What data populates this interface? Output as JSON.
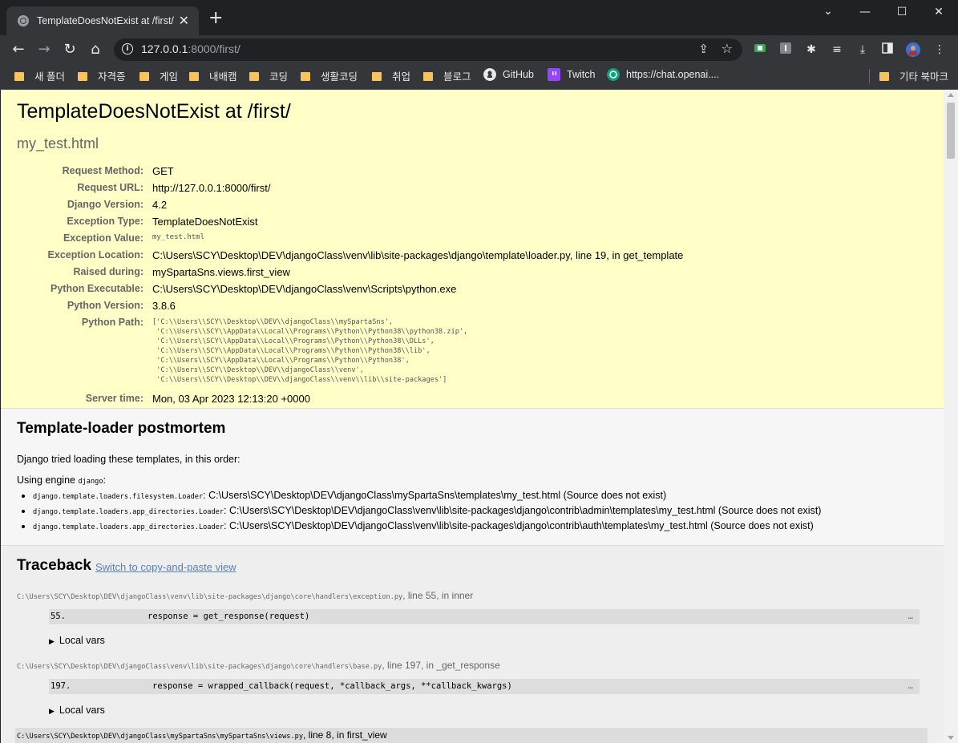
{
  "browser": {
    "tab": {
      "title": "TemplateDoesNotExist at /first/",
      "close": "✕"
    },
    "new_tab": "+",
    "window_controls": {
      "minimize": "—",
      "maximize": "☐",
      "close": "✕",
      "dropdown": "⌄"
    },
    "nav": {
      "back": "←",
      "forward": "→",
      "reload": "↻",
      "home": "⌂"
    },
    "address": {
      "host": "127.0.0.1",
      "port_path": ":8000/first/"
    },
    "bookmarks": [
      {
        "label": "새 폴더",
        "icon": "folder-icon"
      },
      {
        "label": "자격증",
        "icon": "folder-icon"
      },
      {
        "label": "게임",
        "icon": "folder-icon"
      },
      {
        "label": "내배캠",
        "icon": "folder-icon"
      },
      {
        "label": "코딩",
        "icon": "folder-icon"
      },
      {
        "label": "생활코딩",
        "icon": "folder-icon"
      },
      {
        "label": "취업",
        "icon": "folder-icon"
      },
      {
        "label": "블로그",
        "icon": "folder-icon"
      },
      {
        "label": "GitHub",
        "icon": "github-icon"
      },
      {
        "label": "Twitch",
        "icon": "twitch-icon"
      },
      {
        "label": "https://chat.openai....",
        "icon": "openai-icon"
      },
      {
        "label": "기타 북마크",
        "icon": "folder-icon"
      }
    ]
  },
  "error": {
    "title": "TemplateDoesNotExist at /first/",
    "subtitle": "my_test.html",
    "meta": [
      {
        "key": "Request Method:",
        "value": "GET"
      },
      {
        "key": "Request URL:",
        "value": "http://127.0.0.1:8000/first/"
      },
      {
        "key": "Django Version:",
        "value": "4.2"
      },
      {
        "key": "Exception Type:",
        "value": "TemplateDoesNotExist"
      },
      {
        "key": "Exception Value:",
        "value": "my_test.html"
      },
      {
        "key": "Exception Location:",
        "value": "C:\\Users\\SCY\\Desktop\\DEV\\djangoClass\\venv\\lib\\site-packages\\django\\template\\loader.py, line 19, in get_template"
      },
      {
        "key": "Raised during:",
        "value": "mySpartaSns.views.first_view"
      },
      {
        "key": "Python Executable:",
        "value": "C:\\Users\\SCY\\Desktop\\DEV\\djangoClass\\venv\\Scripts\\python.exe"
      },
      {
        "key": "Python Version:",
        "value": "3.8.6"
      },
      {
        "key": "Python Path:",
        "value": "['C:\\\\Users\\\\SCY\\\\Desktop\\\\DEV\\\\djangoClass\\\\mySpartaSns',\n 'C:\\\\Users\\\\SCY\\\\AppData\\\\Local\\\\Programs\\\\Python\\\\Python38\\\\python38.zip',\n 'C:\\\\Users\\\\SCY\\\\AppData\\\\Local\\\\Programs\\\\Python\\\\Python38\\\\DLLs',\n 'C:\\\\Users\\\\SCY\\\\AppData\\\\Local\\\\Programs\\\\Python\\\\Python38\\\\lib',\n 'C:\\\\Users\\\\SCY\\\\AppData\\\\Local\\\\Programs\\\\Python\\\\Python38',\n 'C:\\\\Users\\\\SCY\\\\Desktop\\\\DEV\\\\djangoClass\\\\venv',\n 'C:\\\\Users\\\\SCY\\\\Desktop\\\\DEV\\\\djangoClass\\\\venv\\\\lib\\\\site-packages']"
      },
      {
        "key": "Server time:",
        "value": "Mon, 03 Apr 2023 12:13:20 +0000"
      }
    ]
  },
  "postmortem": {
    "heading": "Template-loader postmortem",
    "intro": "Django tried loading these templates, in this order:",
    "engine_prefix": "Using engine ",
    "engine_name": "django",
    "engine_suffix": ":",
    "loaders": [
      {
        "loader": "django.template.loaders.filesystem.Loader",
        "path": ": C:\\Users\\SCY\\Desktop\\DEV\\djangoClass\\mySpartaSns\\templates\\my_test.html (Source does not exist)"
      },
      {
        "loader": "django.template.loaders.app_directories.Loader",
        "path": ": C:\\Users\\SCY\\Desktop\\DEV\\djangoClass\\venv\\lib\\site-packages\\django\\contrib\\admin\\templates\\my_test.html (Source does not exist)"
      },
      {
        "loader": "django.template.loaders.app_directories.Loader",
        "path": ": C:\\Users\\SCY\\Desktop\\DEV\\djangoClass\\venv\\lib\\site-packages\\django\\contrib\\auth\\templates\\my_test.html (Source does not exist)"
      }
    ]
  },
  "traceback": {
    "heading": "Traceback",
    "switch_link": "Switch to copy-and-paste view",
    "local_vars": "Local vars",
    "frames": [
      {
        "file": "C:\\Users\\SCY\\Desktop\\DEV\\djangoClass\\venv\\lib\\site-packages\\django\\core\\handlers\\exception.py",
        "where": ", line 55, in inner",
        "line_no": "55.",
        "code": "response = get_response(request)"
      },
      {
        "file": "C:\\Users\\SCY\\Desktop\\DEV\\djangoClass\\venv\\lib\\site-packages\\django\\core\\handlers\\base.py",
        "where": ", line 197, in _get_response",
        "line_no": "197.",
        "code": "response = wrapped_callback(request, *callback_args, **callback_kwargs)"
      },
      {
        "file": "C:\\Users\\SCY\\Desktop\\DEV\\djangoClass\\mySpartaSns\\mySpartaSns\\views.py",
        "where": ", line 8, in first_view"
      }
    ],
    "dots": "…"
  },
  "colors": {
    "summary_bg": "#ffffc8",
    "link": "#5b80b2",
    "chrome_dark": "#202124",
    "chrome_toolbar": "#35363a"
  }
}
